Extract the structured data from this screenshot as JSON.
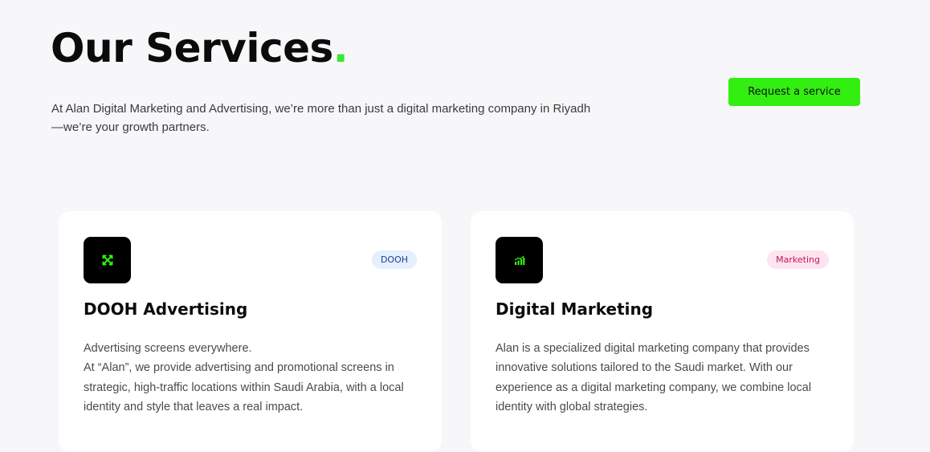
{
  "header": {
    "title_part1": "Our ",
    "title_part2": "Services",
    "title_dot": ".",
    "intro": "At Alan Digital Marketing and Advertising, we’re more than just a digital marketing company in Riyadh—we’re your growth partners.",
    "cta_label": "Request a service"
  },
  "colors": {
    "accent": "#33ee11",
    "background": "#f7f7fa",
    "card": "#ffffff"
  },
  "services": [
    {
      "icon": "expand-arrows-icon",
      "badge": "DOOH",
      "title": "DOOH Advertising",
      "text_line1": "Advertising screens everywhere.",
      "text_line2": "At “Alan”, we provide advertising and promotional screens in strategic, high-traffic locations within Saudi Arabia, with a local identity and style that leaves a real impact."
    },
    {
      "icon": "bar-chart-growth-icon",
      "badge": "Marketing",
      "title": "Digital Marketing",
      "text_line1": "Alan is a specialized digital marketing company that provides innovative solutions tailored to the Saudi market. With our experience as a digital marketing company, we combine local identity with global strategies."
    }
  ]
}
